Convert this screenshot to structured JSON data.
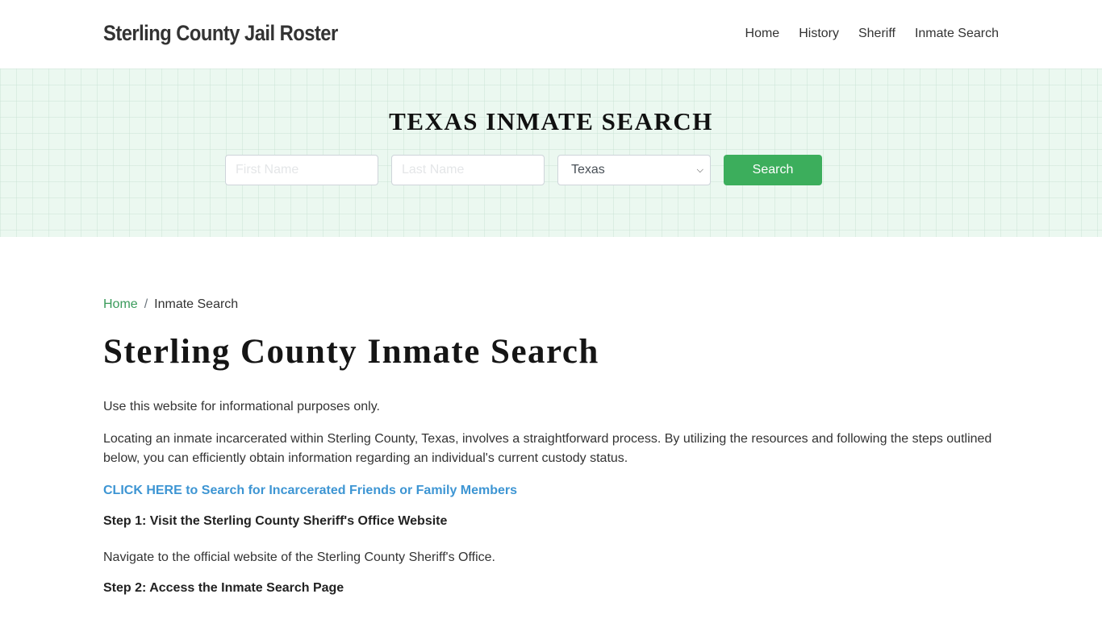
{
  "header": {
    "brand": "Sterling County Jail Roster",
    "nav": [
      {
        "label": "Home"
      },
      {
        "label": "History"
      },
      {
        "label": "Sheriff"
      },
      {
        "label": "Inmate Search"
      }
    ]
  },
  "hero": {
    "title": "TEXAS INMATE SEARCH",
    "first_name_placeholder": "First Name",
    "last_name_placeholder": "Last Name",
    "first_name_value": "",
    "last_name_value": "",
    "state_selected": "Texas",
    "search_label": "Search",
    "accent_color": "#3cae5c"
  },
  "breadcrumb": {
    "home": "Home",
    "separator": "/",
    "current": "Inmate Search"
  },
  "main": {
    "title": "Sterling County Inmate Search",
    "intro": "Use this website for informational purposes only.",
    "paragraph": "Locating an inmate incarcerated within Sterling County, Texas, involves a straightforward process. By utilizing the resources and following the steps outlined below, you can efficiently obtain information regarding an individual's current custody status.",
    "cta_link": "CLICK HERE to Search for Incarcerated Friends or Family Members",
    "step1_heading": "Step 1: Visit the Sterling County Sheriff's Office Website",
    "step1_text": "Navigate to the official website of the Sterling County Sheriff's Office.",
    "step2_heading": "Step 2: Access the Inmate Search Page"
  }
}
